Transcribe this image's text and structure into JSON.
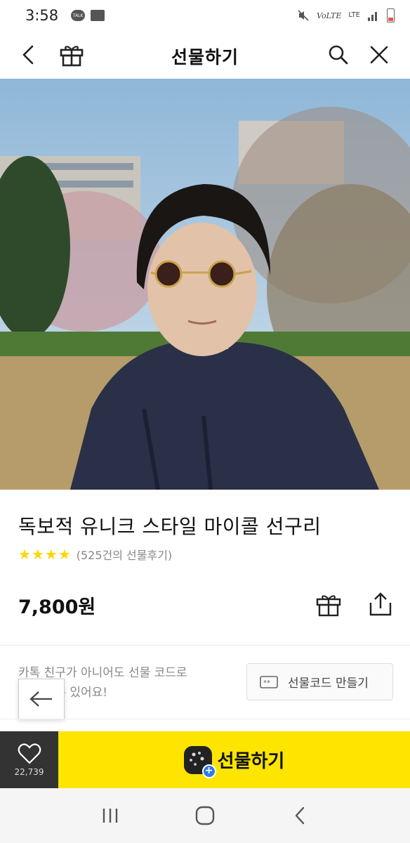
{
  "status_bar": {
    "time": "3:58",
    "talk_label": "TALK",
    "volte": "VoLTE",
    "lte": "LTE"
  },
  "header": {
    "title": "선물하기"
  },
  "product": {
    "name": "독보적 유니크 스타일 마이콜 선구리",
    "rating_stars": 4,
    "review_count_text": "(525건의 선물후기)",
    "price": "7,800원"
  },
  "gift_code": {
    "line1": "카톡 친구가 아니어도 선물 코드로",
    "line2": "선물할 수 있어요!",
    "button_label": "선물코드 만들기"
  },
  "bottom_bar": {
    "like_count": "22,739",
    "gift_label": "선물하기"
  },
  "colors": {
    "accent_yellow": "#fee500",
    "star": "#ffd600",
    "dark": "#333333"
  }
}
